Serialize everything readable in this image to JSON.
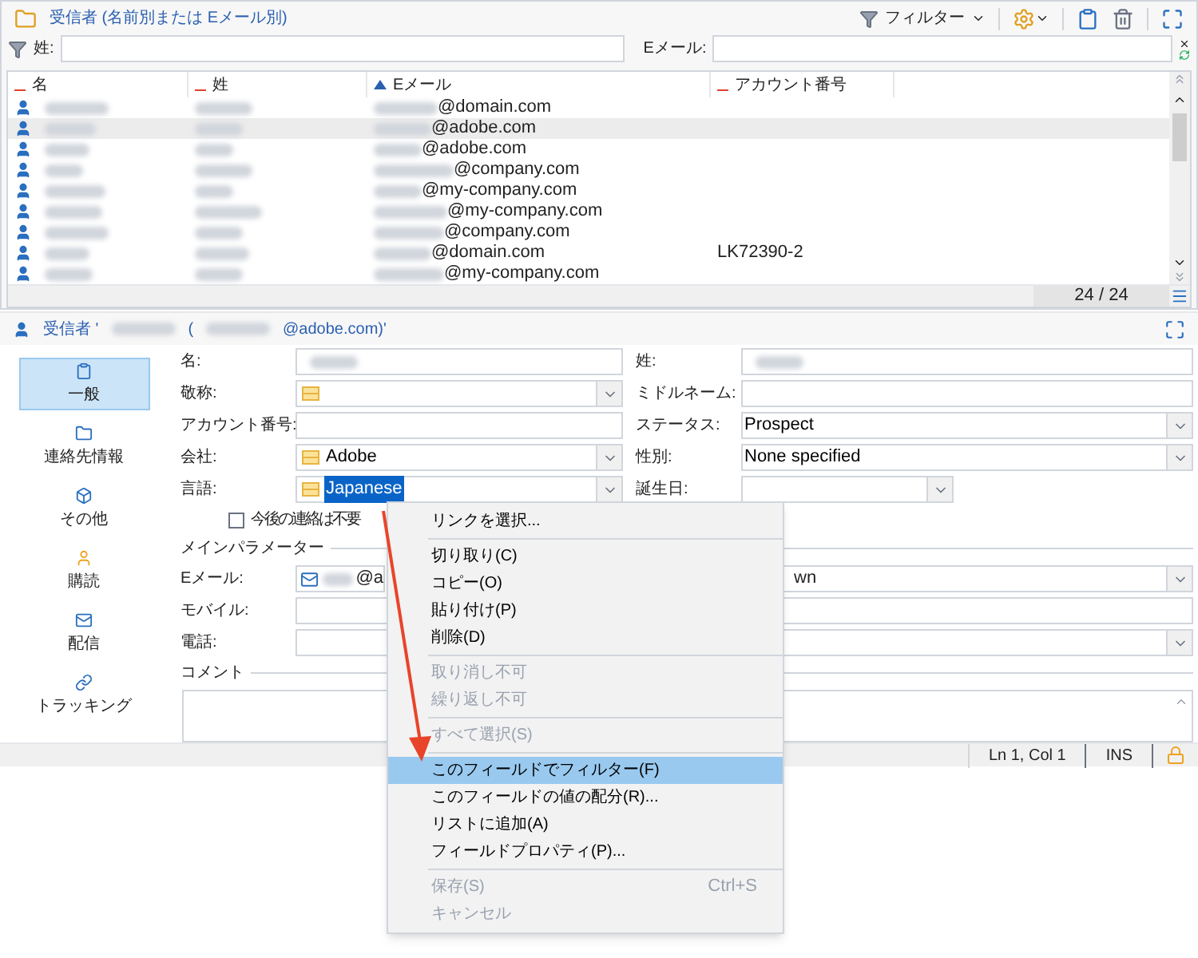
{
  "list_panel": {
    "title": "受信者 (名前別または Eメール別)",
    "toolbar": {
      "filter_label": "フィルター"
    },
    "filters": [
      {
        "label": "姓:"
      },
      {
        "label": "Eメール:"
      }
    ],
    "table": {
      "columns": [
        {
          "label": "名",
          "sorted": false
        },
        {
          "label": "姓",
          "sorted": false
        },
        {
          "label": "Eメール",
          "sorted": true
        },
        {
          "label": "アカウント番号",
          "sorted": false
        }
      ],
      "rows": [
        {
          "email": "@domain.com",
          "selected": false
        },
        {
          "email": "@adobe.com",
          "selected": true
        },
        {
          "email": "@adobe.com",
          "selected": false
        },
        {
          "email": "@company.com",
          "selected": false
        },
        {
          "email": "@my-company.com",
          "selected": false
        },
        {
          "email": "@my-company.com",
          "selected": false
        },
        {
          "email": "@company.com",
          "selected": false
        },
        {
          "email": "@domain.com",
          "account": "LK72390-2",
          "selected": false
        },
        {
          "email": "@my-company.com",
          "selected": false
        }
      ]
    },
    "count": "24 / 24"
  },
  "detail_panel": {
    "title_prefix": "受信者 '",
    "title_mid": " (",
    "title_suffix": "@adobe.com)'",
    "nav": [
      {
        "label": "一般",
        "selected": true
      },
      {
        "label": "連絡先情報",
        "selected": false
      },
      {
        "label": "その他",
        "selected": false
      },
      {
        "label": "購読",
        "selected": false
      },
      {
        "label": "配信",
        "selected": false
      },
      {
        "label": "トラッキング",
        "selected": false
      }
    ],
    "left_fields": [
      {
        "label": "名:",
        "kind": "text",
        "blurred": true
      },
      {
        "label": "敬称:",
        "kind": "link"
      },
      {
        "label": "アカウント番号:",
        "kind": "text"
      },
      {
        "label": "会社:",
        "kind": "link",
        "value": "Adobe"
      },
      {
        "label": "言語:",
        "kind": "link",
        "value": "Japanese",
        "highlighted": true
      }
    ],
    "right_fields": [
      {
        "label": "姓:",
        "kind": "text",
        "blurred": true
      },
      {
        "label": "ミドルネーム:",
        "kind": "text"
      },
      {
        "label": "ステータス:",
        "kind": "select",
        "value": "Prospect"
      },
      {
        "label": "性別:",
        "kind": "select",
        "value": "None specified"
      },
      {
        "label": "誕生日:",
        "kind": "date"
      }
    ],
    "no_contact": {
      "label": "今後の連絡は不要",
      "checked": false
    },
    "section": "メインパラメーター",
    "email": {
      "label": "Eメール:",
      "value": "@a",
      "right_value": "wn"
    },
    "mobile": {
      "label": "モバイル:"
    },
    "phone": {
      "label": "電話:"
    },
    "comment": {
      "label": "コメント"
    }
  },
  "status_bar": {
    "position": "Ln 1, Col 1",
    "mode": "INS"
  },
  "context_menu": [
    {
      "kind": "item",
      "label": "リンクを選択...",
      "disabled": false,
      "selected": false
    },
    {
      "kind": "separator"
    },
    {
      "kind": "item",
      "label": "切り取り(C)",
      "disabled": false,
      "selected": false
    },
    {
      "kind": "item",
      "label": "コピー(O)",
      "disabled": false,
      "selected": false
    },
    {
      "kind": "item",
      "label": "貼り付け(P)",
      "disabled": false,
      "selected": false
    },
    {
      "kind": "item",
      "label": "削除(D)",
      "disabled": false,
      "selected": false
    },
    {
      "kind": "separator"
    },
    {
      "kind": "item",
      "label": "取り消し不可",
      "disabled": true,
      "selected": false
    },
    {
      "kind": "item",
      "label": "繰り返し不可",
      "disabled": true,
      "selected": false
    },
    {
      "kind": "separator"
    },
    {
      "kind": "item",
      "label": "すべて選択(S)",
      "disabled": true,
      "selected": false
    },
    {
      "kind": "separator"
    },
    {
      "kind": "item",
      "label": "このフィールドでフィルター(F)",
      "disabled": false,
      "selected": true
    },
    {
      "kind": "item",
      "label": "このフィールドの値の配分(R)...",
      "disabled": false,
      "selected": false
    },
    {
      "kind": "item",
      "label": "リストに追加(A)",
      "disabled": false,
      "selected": false
    },
    {
      "kind": "item",
      "label": "フィールドプロパティ(P)...",
      "disabled": false,
      "selected": false
    },
    {
      "kind": "separator"
    },
    {
      "kind": "item",
      "label": "保存(S)",
      "shortcut": "Ctrl+S",
      "disabled": true,
      "selected": false
    },
    {
      "kind": "item",
      "label": "キャンセル",
      "disabled": true,
      "selected": false
    }
  ]
}
